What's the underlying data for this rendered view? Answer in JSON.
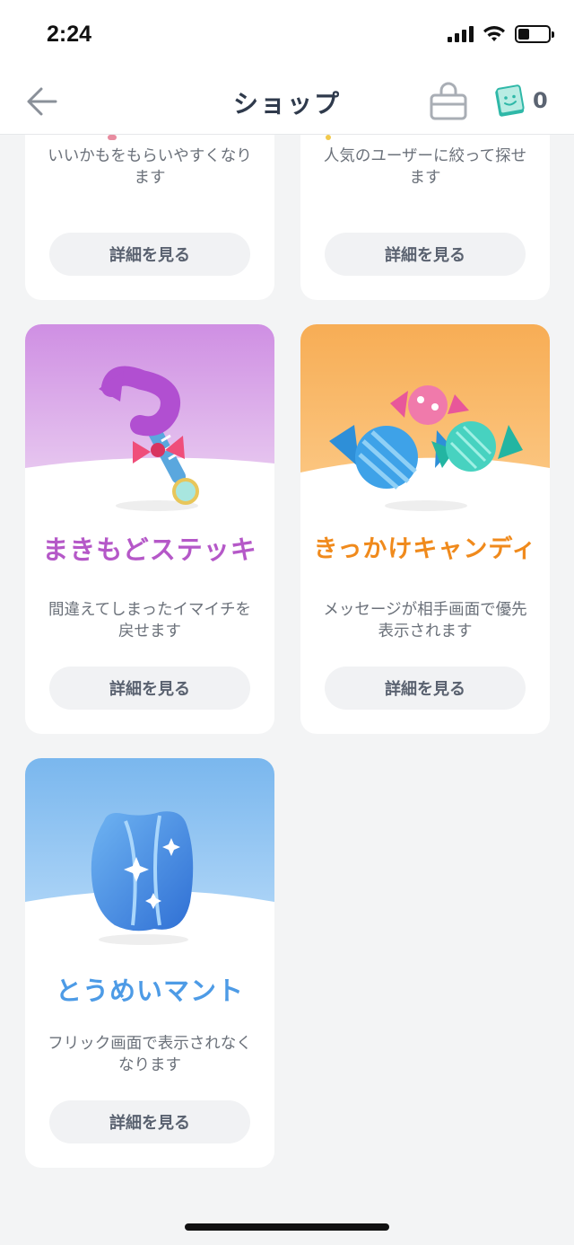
{
  "status_bar": {
    "time": "2:24"
  },
  "nav": {
    "title": "ショップ",
    "ticket_count": "0",
    "back_icon": "back-arrow-icon",
    "bag_icon": "shopping-bag-icon",
    "ticket_icon": "ticket-face-icon"
  },
  "items": [
    {
      "desc": "いいかもをもらいやすくなります",
      "button": "詳細を見る"
    },
    {
      "desc": "人気のユーザーに絞って探せます",
      "button": "詳細を見る"
    },
    {
      "logo": "まきもどステッキ",
      "desc": "間違えてしまったイマイチを戻せます",
      "button": "詳細を見る",
      "color": "#b558c8"
    },
    {
      "logo": "きっかけキャンディ",
      "desc": "メッセージが相手画面で優先表示されます",
      "button": "詳細を見る",
      "color": "#f08a1c"
    },
    {
      "logo": "とうめいマント",
      "desc": "フリック画面で表示されなくなります",
      "button": "詳細を見る",
      "color": "#4d9be6"
    }
  ]
}
